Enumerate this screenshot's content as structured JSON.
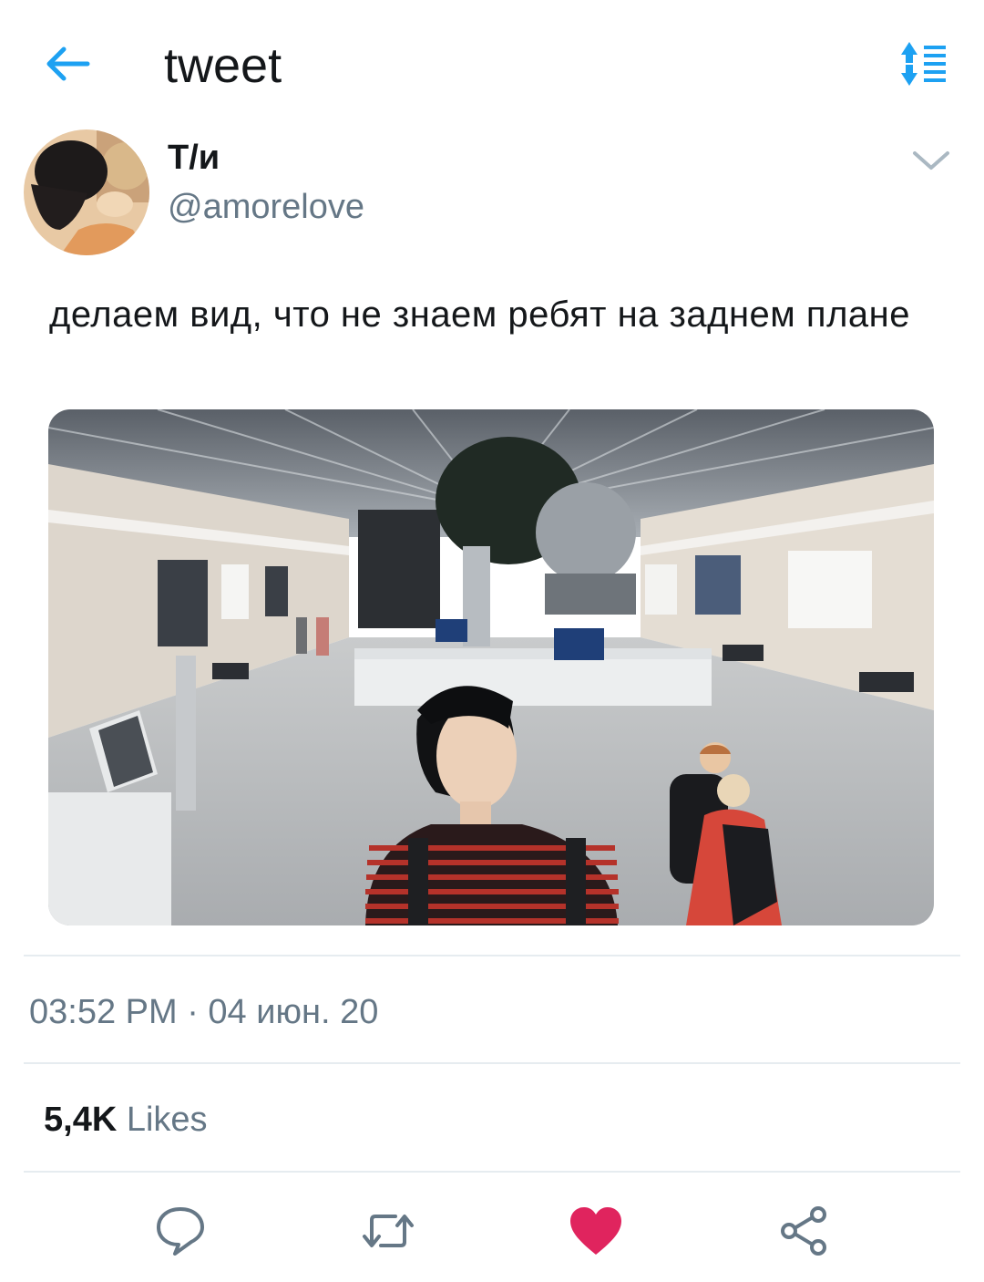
{
  "header": {
    "title": "tweet",
    "accent_color": "#1da1f2"
  },
  "tweet": {
    "author_name": "Т/и",
    "author_handle": "@amorelove",
    "text": "делаем вид, что не знаем ребят на заднем плане",
    "timestamp": "03:52 PM · 04 июн. 20",
    "likes_count": "5,4K",
    "likes_label": "Likes",
    "liked": true,
    "like_color": "#e0245e"
  },
  "icons": {
    "back": "arrow-left-icon",
    "sort": "sort-arrows-list-icon",
    "more": "chevron-down-icon",
    "reply": "speech-bubble-icon",
    "retweet": "retweet-icon",
    "like": "heart-icon",
    "share": "share-icon"
  }
}
